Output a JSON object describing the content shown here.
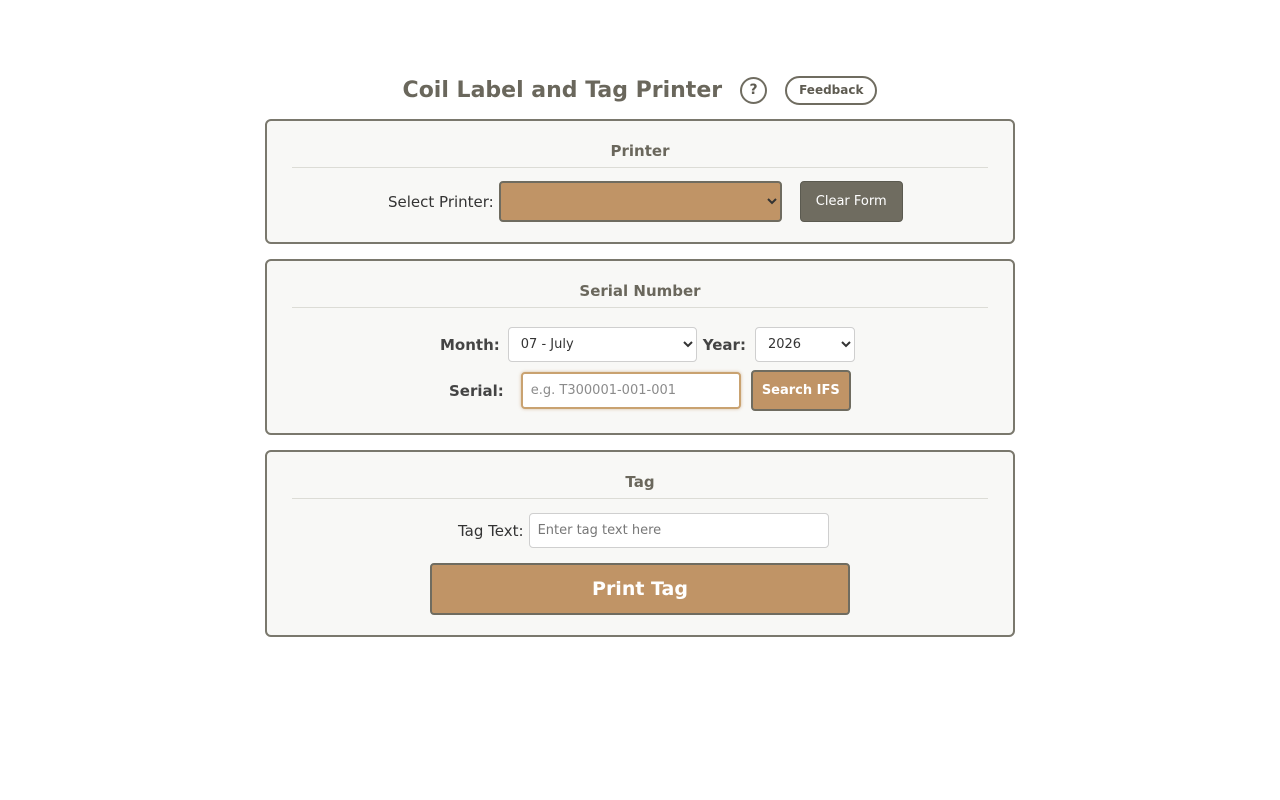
{
  "header": {
    "title": "Coil Label and Tag Printer",
    "help_label": "?",
    "feedback_label": "Feedback"
  },
  "printer_section": {
    "title": "Printer",
    "select_label": "Select Printer:",
    "selected_value": "",
    "clear_label": "Clear Form"
  },
  "serial_section": {
    "title": "Serial Number",
    "month_label": "Month:",
    "month_value": "07 - July",
    "year_label": "Year:",
    "year_value": "2026",
    "serial_label": "Serial:",
    "serial_placeholder": "e.g. T300001-001-001",
    "search_label": "Search IFS"
  },
  "tag_section": {
    "title": "Tag",
    "tag_text_label": "Tag Text:",
    "tag_text_placeholder": "Enter tag text here",
    "print_label": "Print Tag"
  },
  "colors": {
    "accent": "#c09466",
    "dark": "#6f6c60",
    "card_bg": "#f8f8f6",
    "border": "#7a786d"
  }
}
